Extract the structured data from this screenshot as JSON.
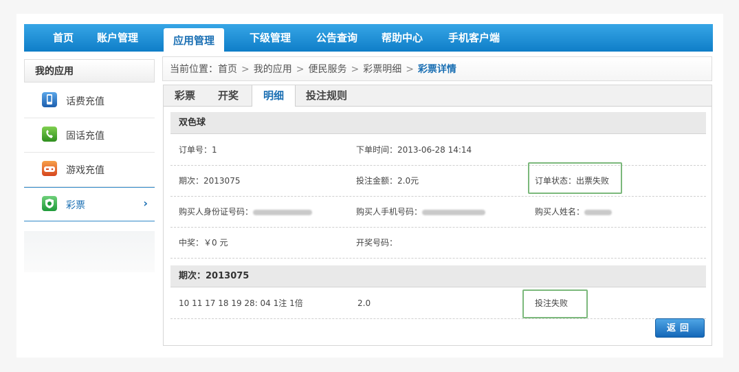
{
  "nav": {
    "items": [
      "首页",
      "账户管理",
      "应用管理",
      "下级管理",
      "公告查询",
      "帮助中心",
      "手机客户端"
    ],
    "active": "应用管理"
  },
  "sidebar": {
    "title": "我的应用",
    "items": [
      {
        "label": "话费充值",
        "icon": "phone-icon"
      },
      {
        "label": "固话充值",
        "icon": "landline-icon"
      },
      {
        "label": "游戏充值",
        "icon": "gamepad-icon"
      },
      {
        "label": "彩票",
        "icon": "lottery-icon"
      }
    ],
    "active": "彩票",
    "chevron": "›"
  },
  "breadcrumb": {
    "prefix": "当前位置：",
    "items": [
      "首页",
      "我的应用",
      "便民服务",
      "彩票明细"
    ],
    "current": "彩票详情",
    "separator": ">"
  },
  "tabs": {
    "items": [
      "彩票",
      "开奖",
      "明细",
      "投注规则"
    ],
    "active": "明细"
  },
  "detail": {
    "section_title": "双色球",
    "order_no_label": "订单号：",
    "order_no": "1",
    "order_time_label": "下单时间：",
    "order_time": "2013-06-28 14:14",
    "issue_label": "期次：",
    "issue": "2013075",
    "amount_label": "投注金额：",
    "amount": "2.0元",
    "status_label": "订单状态：",
    "status": "出票失败",
    "buyer_id_label": "购买人身份证号码：",
    "buyer_phone_label": "购买人手机号码：",
    "buyer_name_label": "购买人姓名：",
    "prize_label": "中奖：",
    "prize": "￥0 元",
    "draw_no_label": "开奖号码：",
    "draw_no": ""
  },
  "bets": {
    "section_label": "期次：",
    "section_issue": "2013075",
    "row": {
      "numbers": "10 11 17 18 19 28: 04 1注 1倍",
      "amount": "2.0",
      "status": "投注失败"
    }
  },
  "back_button": "返回",
  "colors": {
    "nav_bg": "#1a8fd8",
    "accent": "#1a6fb3",
    "highlight_border": "#7bb87b"
  }
}
